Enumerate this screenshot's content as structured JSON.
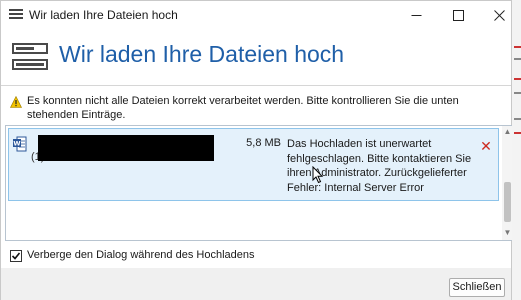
{
  "window": {
    "title": "Wir laden Ihre Dateien hoch",
    "controls": {
      "minimize": "—",
      "maximize": "☐",
      "close": "✕"
    }
  },
  "header": {
    "title": "Wir laden Ihre Dateien hoch",
    "icon": "upload-progress-icon"
  },
  "warning": {
    "icon": "warning-icon",
    "text": "Es konnten nicht alle Dateien korrekt verarbeitet werden. Bitte kontrollieren Sie die unten stehenden Einträge."
  },
  "files": [
    {
      "icon": "word-document-icon",
      "name_visible_fragment": "(1).docx",
      "size": "5,8 MB",
      "error": "Das Hochladen ist unerwartet fehlgeschlagen. Bitte kontaktieren Sie ihren Administrator. Zurückgelieferter Fehler: Internal Server Error",
      "remove_icon": "✕"
    }
  ],
  "option": {
    "checked": true,
    "label": "Verberge den Dialog während des Hochladens"
  },
  "footer": {
    "close_label": "Schließen"
  },
  "colors": {
    "accent": "#1f5fa8",
    "selection_bg": "#e4f1fb",
    "selection_border": "#8ec4ea",
    "error_red": "#cc2a1e",
    "warning_yellow": "#f2c200"
  }
}
